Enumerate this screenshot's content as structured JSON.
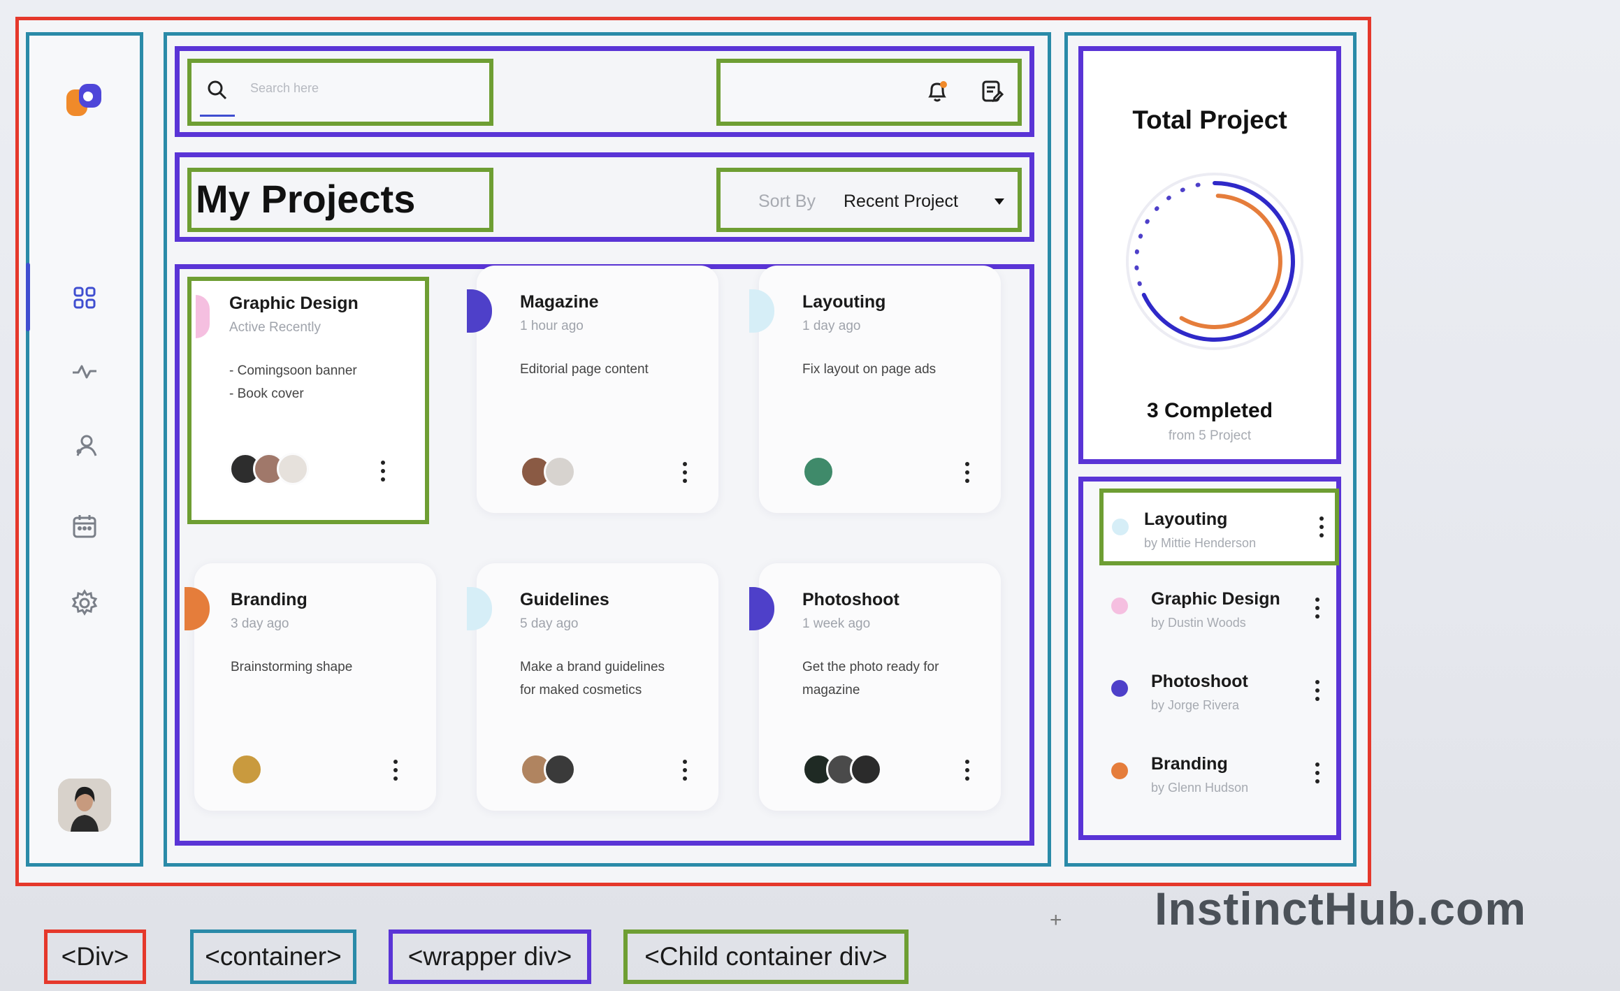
{
  "header": {
    "search_placeholder": "Search here"
  },
  "title": {
    "heading": "My Projects",
    "sort_label": "Sort By",
    "sort_value": "Recent Project"
  },
  "cards": [
    {
      "title": "Graphic Design",
      "time": "Active Recently",
      "desc": "- Comingsoon banner\n- Book cover",
      "color": "#f5bfe0"
    },
    {
      "title": "Magazine",
      "time": "1 hour ago",
      "desc": "Editorial page content",
      "color": "#4e40c9"
    },
    {
      "title": "Layouting",
      "time": "1 day ago",
      "desc": "Fix layout on page ads",
      "color": "#d6eef7"
    },
    {
      "title": "Branding",
      "time": "3 day ago",
      "desc": "Brainstorming shape",
      "color": "#e57d3b"
    },
    {
      "title": "Guidelines",
      "time": "5 day ago",
      "desc": "Make a brand guidelines\nfor maked cosmetics",
      "color": "#d6eef7"
    },
    {
      "title": "Photoshoot",
      "time": "1 week ago",
      "desc": "Get the photo ready for\nmagazine",
      "color": "#4e40c9"
    }
  ],
  "total": {
    "title": "Total Project",
    "completed": "3 Completed",
    "from": "from 5 Project",
    "progress_fraction": 0.6
  },
  "recent_list": [
    {
      "title": "Layouting",
      "by": "by Mittie Henderson",
      "color": "#d6eef7"
    },
    {
      "title": "Graphic Design",
      "by": "by Dustin Woods",
      "color": "#f5bfe0"
    },
    {
      "title": "Photoshoot",
      "by": "by Jorge Rivera",
      "color": "#4e40c9"
    },
    {
      "title": "Branding",
      "by": "by Glenn Hudson",
      "color": "#e57d3b"
    }
  ],
  "legend": {
    "div": "<Div>",
    "container": "<container>",
    "wrapper": "<wrapper div>",
    "child": "<Child container div>"
  },
  "watermark": "InstinctHub.com",
  "colors": {
    "red": "#e5382b",
    "teal": "#2a8aa8",
    "purple": "#5a34d6",
    "green": "#6e9e33",
    "accent": "#3f4ed0",
    "orange": "#e57d3b"
  }
}
